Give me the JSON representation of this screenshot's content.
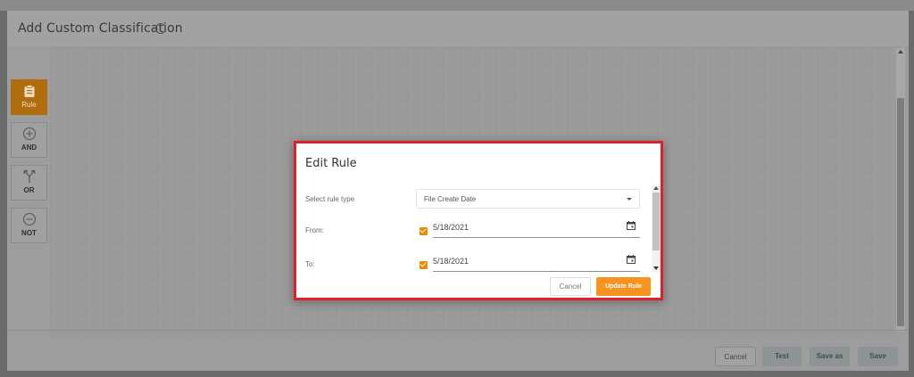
{
  "panel": {
    "title": "Add Custom Classification"
  },
  "toolbar": {
    "rule_label": "Rule",
    "and_label": "AND",
    "or_label": "OR",
    "not_label": "NOT"
  },
  "footer": {
    "cancel_label": "Cancel",
    "test_label": "Test",
    "save_as_label": "Save as",
    "save_label": "Save"
  },
  "modal": {
    "title": "Edit Rule",
    "rule_type_label": "Select rule type",
    "rule_type_value": "File Create Date",
    "from_label": "From:",
    "from_value": "5/18/2021",
    "to_label": "To:",
    "to_value": "5/18/2021",
    "cancel_label": "Cancel",
    "update_label": "Update Rule"
  },
  "colors": {
    "accent": "#f7931e",
    "highlight_border": "#e01f2d"
  }
}
